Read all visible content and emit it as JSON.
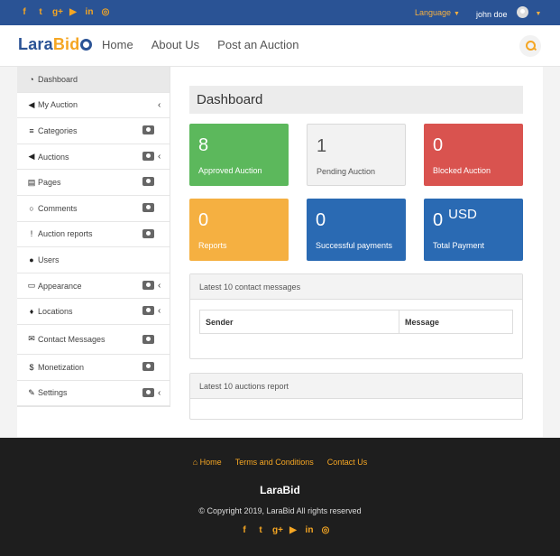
{
  "topbar": {
    "social": [
      {
        "name": "facebook-icon",
        "glyph": "f"
      },
      {
        "name": "twitter-icon",
        "glyph": "t"
      },
      {
        "name": "google-plus-icon",
        "glyph": "g+"
      },
      {
        "name": "youtube-icon",
        "glyph": "▶"
      },
      {
        "name": "linkedin-icon",
        "glyph": "in"
      },
      {
        "name": "dribbble-icon",
        "glyph": "◎"
      }
    ],
    "language_label": "Language",
    "user_name": "john doe"
  },
  "header": {
    "logo_part1": "Lara",
    "logo_part2": "Bid",
    "nav": [
      "Home",
      "About Us",
      "Post an Auction"
    ]
  },
  "sidebar": {
    "items": [
      {
        "label": "Dashboard",
        "icon": "dashboard-icon",
        "glyph": "◔"
      },
      {
        "label": "My Auction",
        "icon": "bullhorn-icon",
        "glyph": "◀"
      },
      {
        "label": "Categories",
        "icon": "list-icon",
        "glyph": "≡"
      },
      {
        "label": "Auctions",
        "icon": "bullhorn-icon",
        "glyph": "◀"
      },
      {
        "label": "Pages",
        "icon": "file-icon",
        "glyph": "▤"
      },
      {
        "label": "Comments",
        "icon": "comment-icon",
        "glyph": "○"
      },
      {
        "label": "Auction reports",
        "icon": "exclamation-icon",
        "glyph": "!"
      },
      {
        "label": "Users",
        "icon": "users-icon",
        "glyph": "●"
      },
      {
        "label": "Appearance",
        "icon": "desktop-icon",
        "glyph": "▭"
      },
      {
        "label": "Locations",
        "icon": "map-marker-icon",
        "glyph": "♦"
      },
      {
        "label": "Contact Messages",
        "icon": "envelope-icon",
        "glyph": "✉"
      },
      {
        "label": "Monetization",
        "icon": "dollar-icon",
        "glyph": "$"
      },
      {
        "label": "Settings",
        "icon": "wrench-icon",
        "glyph": "✎"
      }
    ]
  },
  "main": {
    "title": "Dashboard",
    "cards": [
      {
        "value": "8",
        "label": "Approved Auction",
        "color": "#5cb85c"
      },
      {
        "value": "1",
        "label": "Pending Auction",
        "color": "#f2f2f2"
      },
      {
        "value": "0",
        "label": "Blocked Auction",
        "color": "#d9534f"
      },
      {
        "value": "0",
        "label": "Reports",
        "color": "#f5b041"
      },
      {
        "value": "0",
        "label": "Successful payments",
        "color": "#2a6ab3"
      },
      {
        "value": "0",
        "suffix": "USD",
        "label": "Total Payment",
        "color": "#2a6ab3"
      }
    ],
    "contact_panel": {
      "title": "Latest 10 contact messages",
      "col_sender": "Sender",
      "col_message": "Message"
    },
    "reports_panel": {
      "title": "Latest 10 auctions report"
    }
  },
  "footer": {
    "links": [
      "Home",
      "Terms and Conditions",
      "Contact Us"
    ],
    "brand": "LaraBid",
    "copyright": "© Copyright 2019, LaraBid All rights reserved"
  }
}
